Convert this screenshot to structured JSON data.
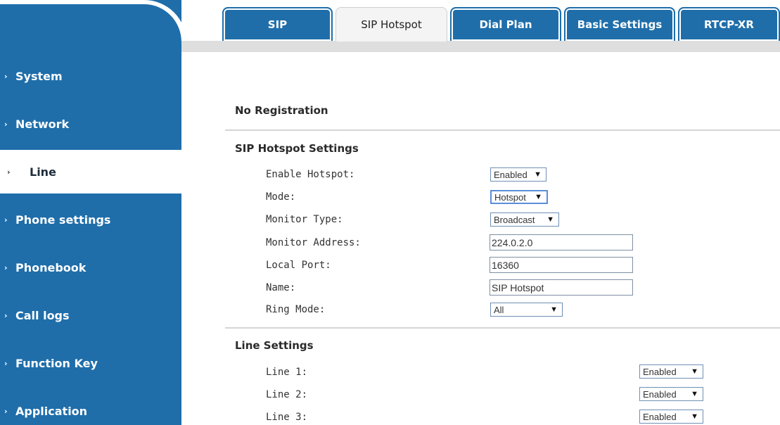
{
  "sidebar": {
    "items": [
      {
        "label": "System"
      },
      {
        "label": "Network"
      },
      {
        "label": "Line"
      },
      {
        "label": "Phone settings"
      },
      {
        "label": "Phonebook"
      },
      {
        "label": "Call logs"
      },
      {
        "label": "Function Key"
      },
      {
        "label": "Application"
      }
    ],
    "active": "Line"
  },
  "tabs": [
    {
      "label": "SIP"
    },
    {
      "label": "SIP Hotspot"
    },
    {
      "label": "Dial Plan"
    },
    {
      "label": "Basic Settings"
    },
    {
      "label": "RTCP-XR"
    }
  ],
  "active_tab": "SIP Hotspot",
  "status": {
    "registration": "No Registration"
  },
  "hotspot": {
    "title": "SIP Hotspot Settings",
    "enable_label": "Enable Hotspot:",
    "enable_value": "Enabled",
    "mode_label": "Mode:",
    "mode_value": "Hotspot",
    "monitor_type_label": "Monitor Type:",
    "monitor_type_value": "Broadcast",
    "monitor_address_label": "Monitor Address:",
    "monitor_address_value": "224.0.2.0",
    "local_port_label": "Local Port:",
    "local_port_value": "16360",
    "name_label": "Name:",
    "name_value": "SIP Hotspot",
    "ring_mode_label": "Ring Mode:",
    "ring_mode_value": "All"
  },
  "line_settings": {
    "title": "Line Settings",
    "lines": [
      {
        "label": "Line 1:",
        "value": "Enabled"
      },
      {
        "label": "Line 2:",
        "value": "Enabled"
      },
      {
        "label": "Line 3:",
        "value": "Enabled"
      }
    ]
  },
  "icons": {
    "nav_arrow": "chevron-right-icon",
    "dropdown": "caret-down-icon"
  },
  "colors": {
    "brand_blue": "#1f6eaa",
    "active_bg": "#ffffff"
  }
}
